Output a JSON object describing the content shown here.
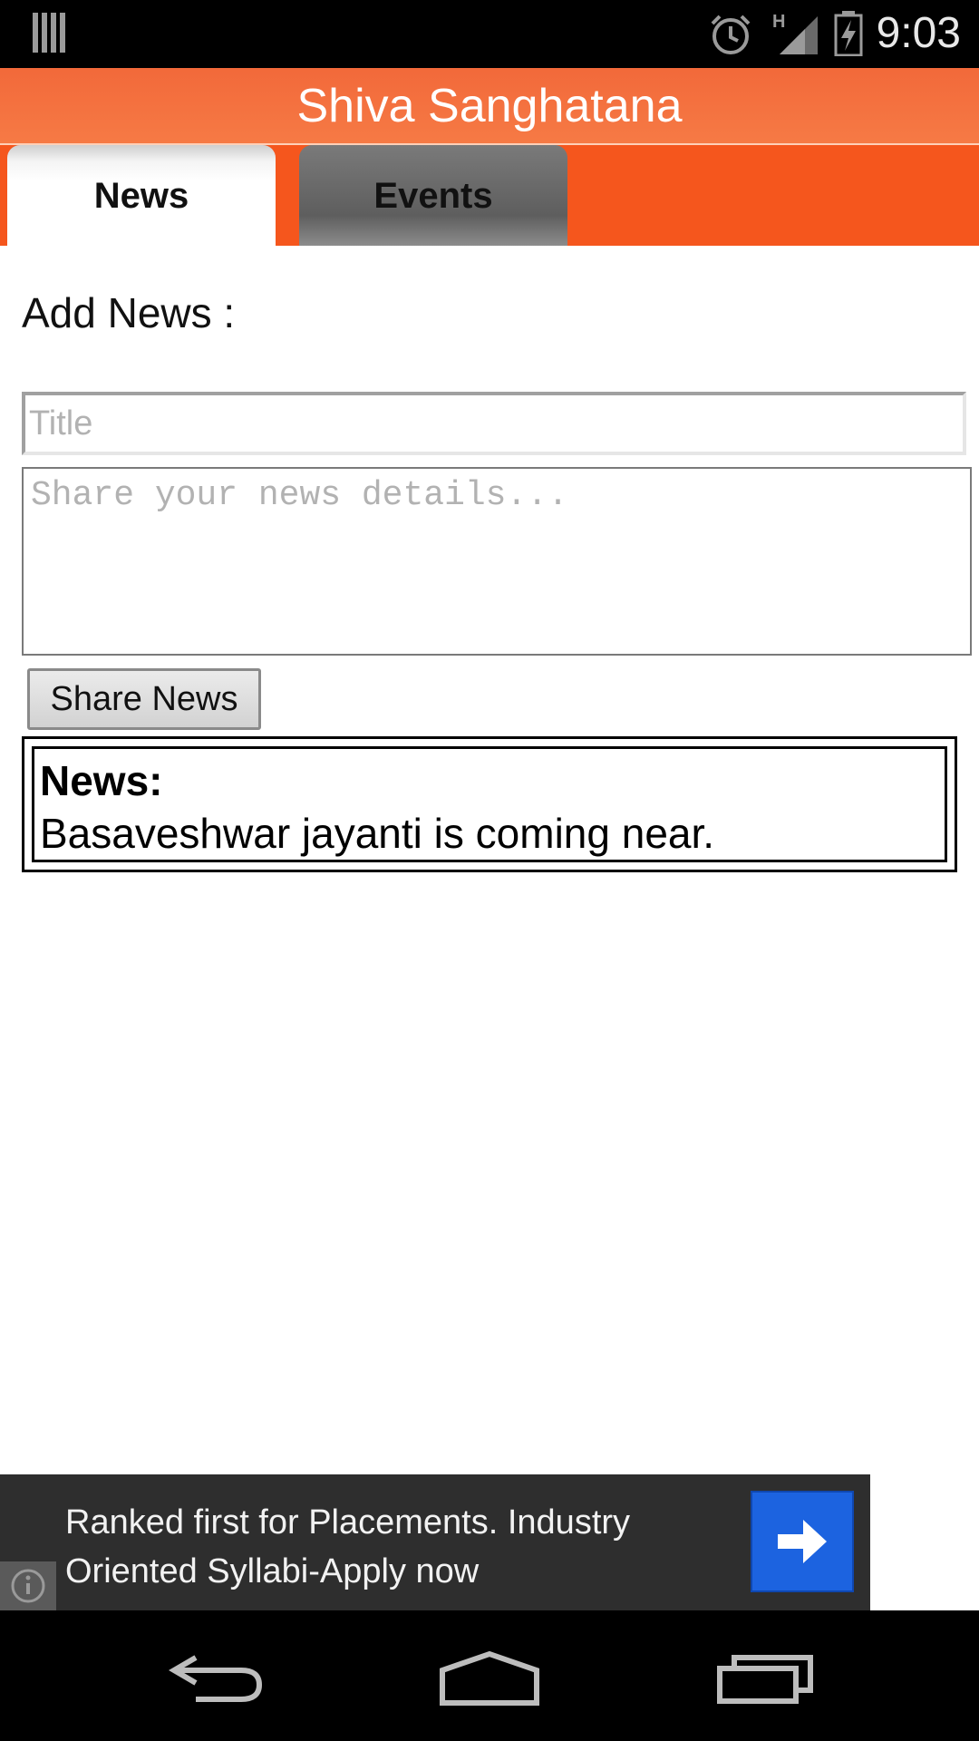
{
  "status_bar": {
    "time": "9:03",
    "network_type": "H",
    "icons": [
      "notification-bars-icon",
      "alarm-icon",
      "signal-icon",
      "battery-charging-icon"
    ]
  },
  "app": {
    "title": "Shiva Sanghatana",
    "accent": "#f5561d"
  },
  "tabs": [
    {
      "label": "News",
      "selected": true
    },
    {
      "label": "Events",
      "selected": false
    }
  ],
  "form": {
    "heading": "Add News :",
    "title_placeholder": "Title",
    "details_placeholder": "Share your news details...",
    "share_label": "Share News"
  },
  "news_item": {
    "heading": "News:",
    "text": "Basaveshwar jayanti is coming near."
  },
  "ad": {
    "text": "Ranked first for Placements. Industry Oriented Syllabi-Apply now",
    "button_color": "#1c63e0"
  },
  "nav": [
    "back-icon",
    "home-icon",
    "recents-icon"
  ]
}
